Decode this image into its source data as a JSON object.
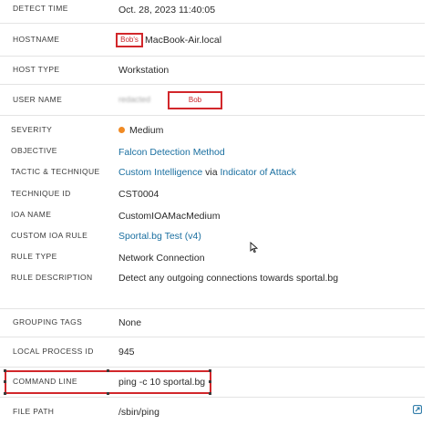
{
  "fields": {
    "detect_time": {
      "label": "DETECT TIME",
      "value": "Oct. 28, 2023 11:40:05"
    },
    "hostname": {
      "label": "HOSTNAME",
      "redacted": "Bob's",
      "value": "MacBook-Air.local"
    },
    "host_type": {
      "label": "HOST TYPE",
      "value": "Workstation"
    },
    "user_name": {
      "label": "USER NAME",
      "redacted": "Bob",
      "blurred": "redacted"
    },
    "severity": {
      "label": "SEVERITY",
      "value": "Medium",
      "dot_color": "#f08a24"
    },
    "objective": {
      "label": "OBJECTIVE",
      "value": "Falcon Detection Method"
    },
    "tactic": {
      "label": "TACTIC & TECHNIQUE",
      "tactic": "Custom Intelligence",
      "via": "via",
      "technique": "Indicator of Attack"
    },
    "technique_id": {
      "label": "TECHNIQUE ID",
      "value": "CST0004"
    },
    "ioa_name": {
      "label": "IOA NAME",
      "value": "CustomIOAMacMedium"
    },
    "custom_ioa_rule": {
      "label": "CUSTOM IOA RULE",
      "value": "Sportal.bg Test (v4)"
    },
    "rule_type": {
      "label": "RULE TYPE",
      "value": "Network Connection"
    },
    "rule_description": {
      "label": "RULE DESCRIPTION",
      "value": "Detect any outgoing connections towards sportal.bg"
    },
    "grouping_tags": {
      "label": "GROUPING TAGS",
      "value": "None"
    },
    "local_process_id": {
      "label": "LOCAL PROCESS ID",
      "value": "945"
    },
    "command_line": {
      "label": "COMMAND LINE",
      "value": "ping -c 10 sportal.bg"
    },
    "file_path": {
      "label": "FILE PATH",
      "value": "/sbin/ping"
    }
  },
  "colors": {
    "link": "#1a6fa0",
    "highlight": "#d2272b"
  },
  "icons": {
    "external_link": "external-link-icon",
    "cursor": "mouse-cursor-icon"
  }
}
